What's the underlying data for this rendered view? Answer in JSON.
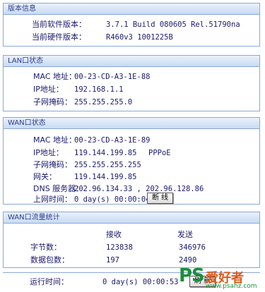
{
  "version": {
    "title": "版本信息",
    "software_label": "当前软件版本：",
    "software_value": "3.7.1 Build 080605 Rel.51790na",
    "hardware_label": "当前硬件版本：",
    "hardware_value": "R460v3 1001225B"
  },
  "lan": {
    "title": "LAN口状态",
    "mac_label": "MAC 地址：",
    "mac_value": "00-23-CD-A3-1E-88",
    "ip_label": "IP地址：",
    "ip_value": "192.168.1.1",
    "mask_label": "子网掩码：",
    "mask_value": "255.255.255.0"
  },
  "wan": {
    "title": "WAN口状态",
    "mac_label": "MAC 地址：",
    "mac_value": "00-23-CD-A3-1E-89",
    "ip_label": "IP地址：",
    "ip_value": "119.144.199.85",
    "conn_type": "PPPoE",
    "mask_label": "子网掩码：",
    "mask_value": "255.255.255.255",
    "gateway_label": "网关：",
    "gateway_value": "119.144.199.85",
    "dns_label": "DNS 服务器：",
    "dns_value": "202.96.134.33 , 202.96.128.86",
    "uptime_label": "上网时间：",
    "uptime_value": "0 day(s) 00:00:04",
    "disconnect_label": "断 线"
  },
  "traffic": {
    "title": "WAN口流量统计",
    "col_recv": "接收",
    "col_send": "发送",
    "bytes_label": "字节数：",
    "bytes_recv": "123838",
    "bytes_send": "346976",
    "packets_label": "数据包数：",
    "packets_recv": "197",
    "packets_send": "2490"
  },
  "runtime": {
    "label": "运行时间：",
    "value": "0 day(s) 00:00:53",
    "refresh_label": "刷 新"
  },
  "watermark": {
    "ps": "PS",
    "cn": "爱好者",
    "url": "www.psahz.com"
  }
}
